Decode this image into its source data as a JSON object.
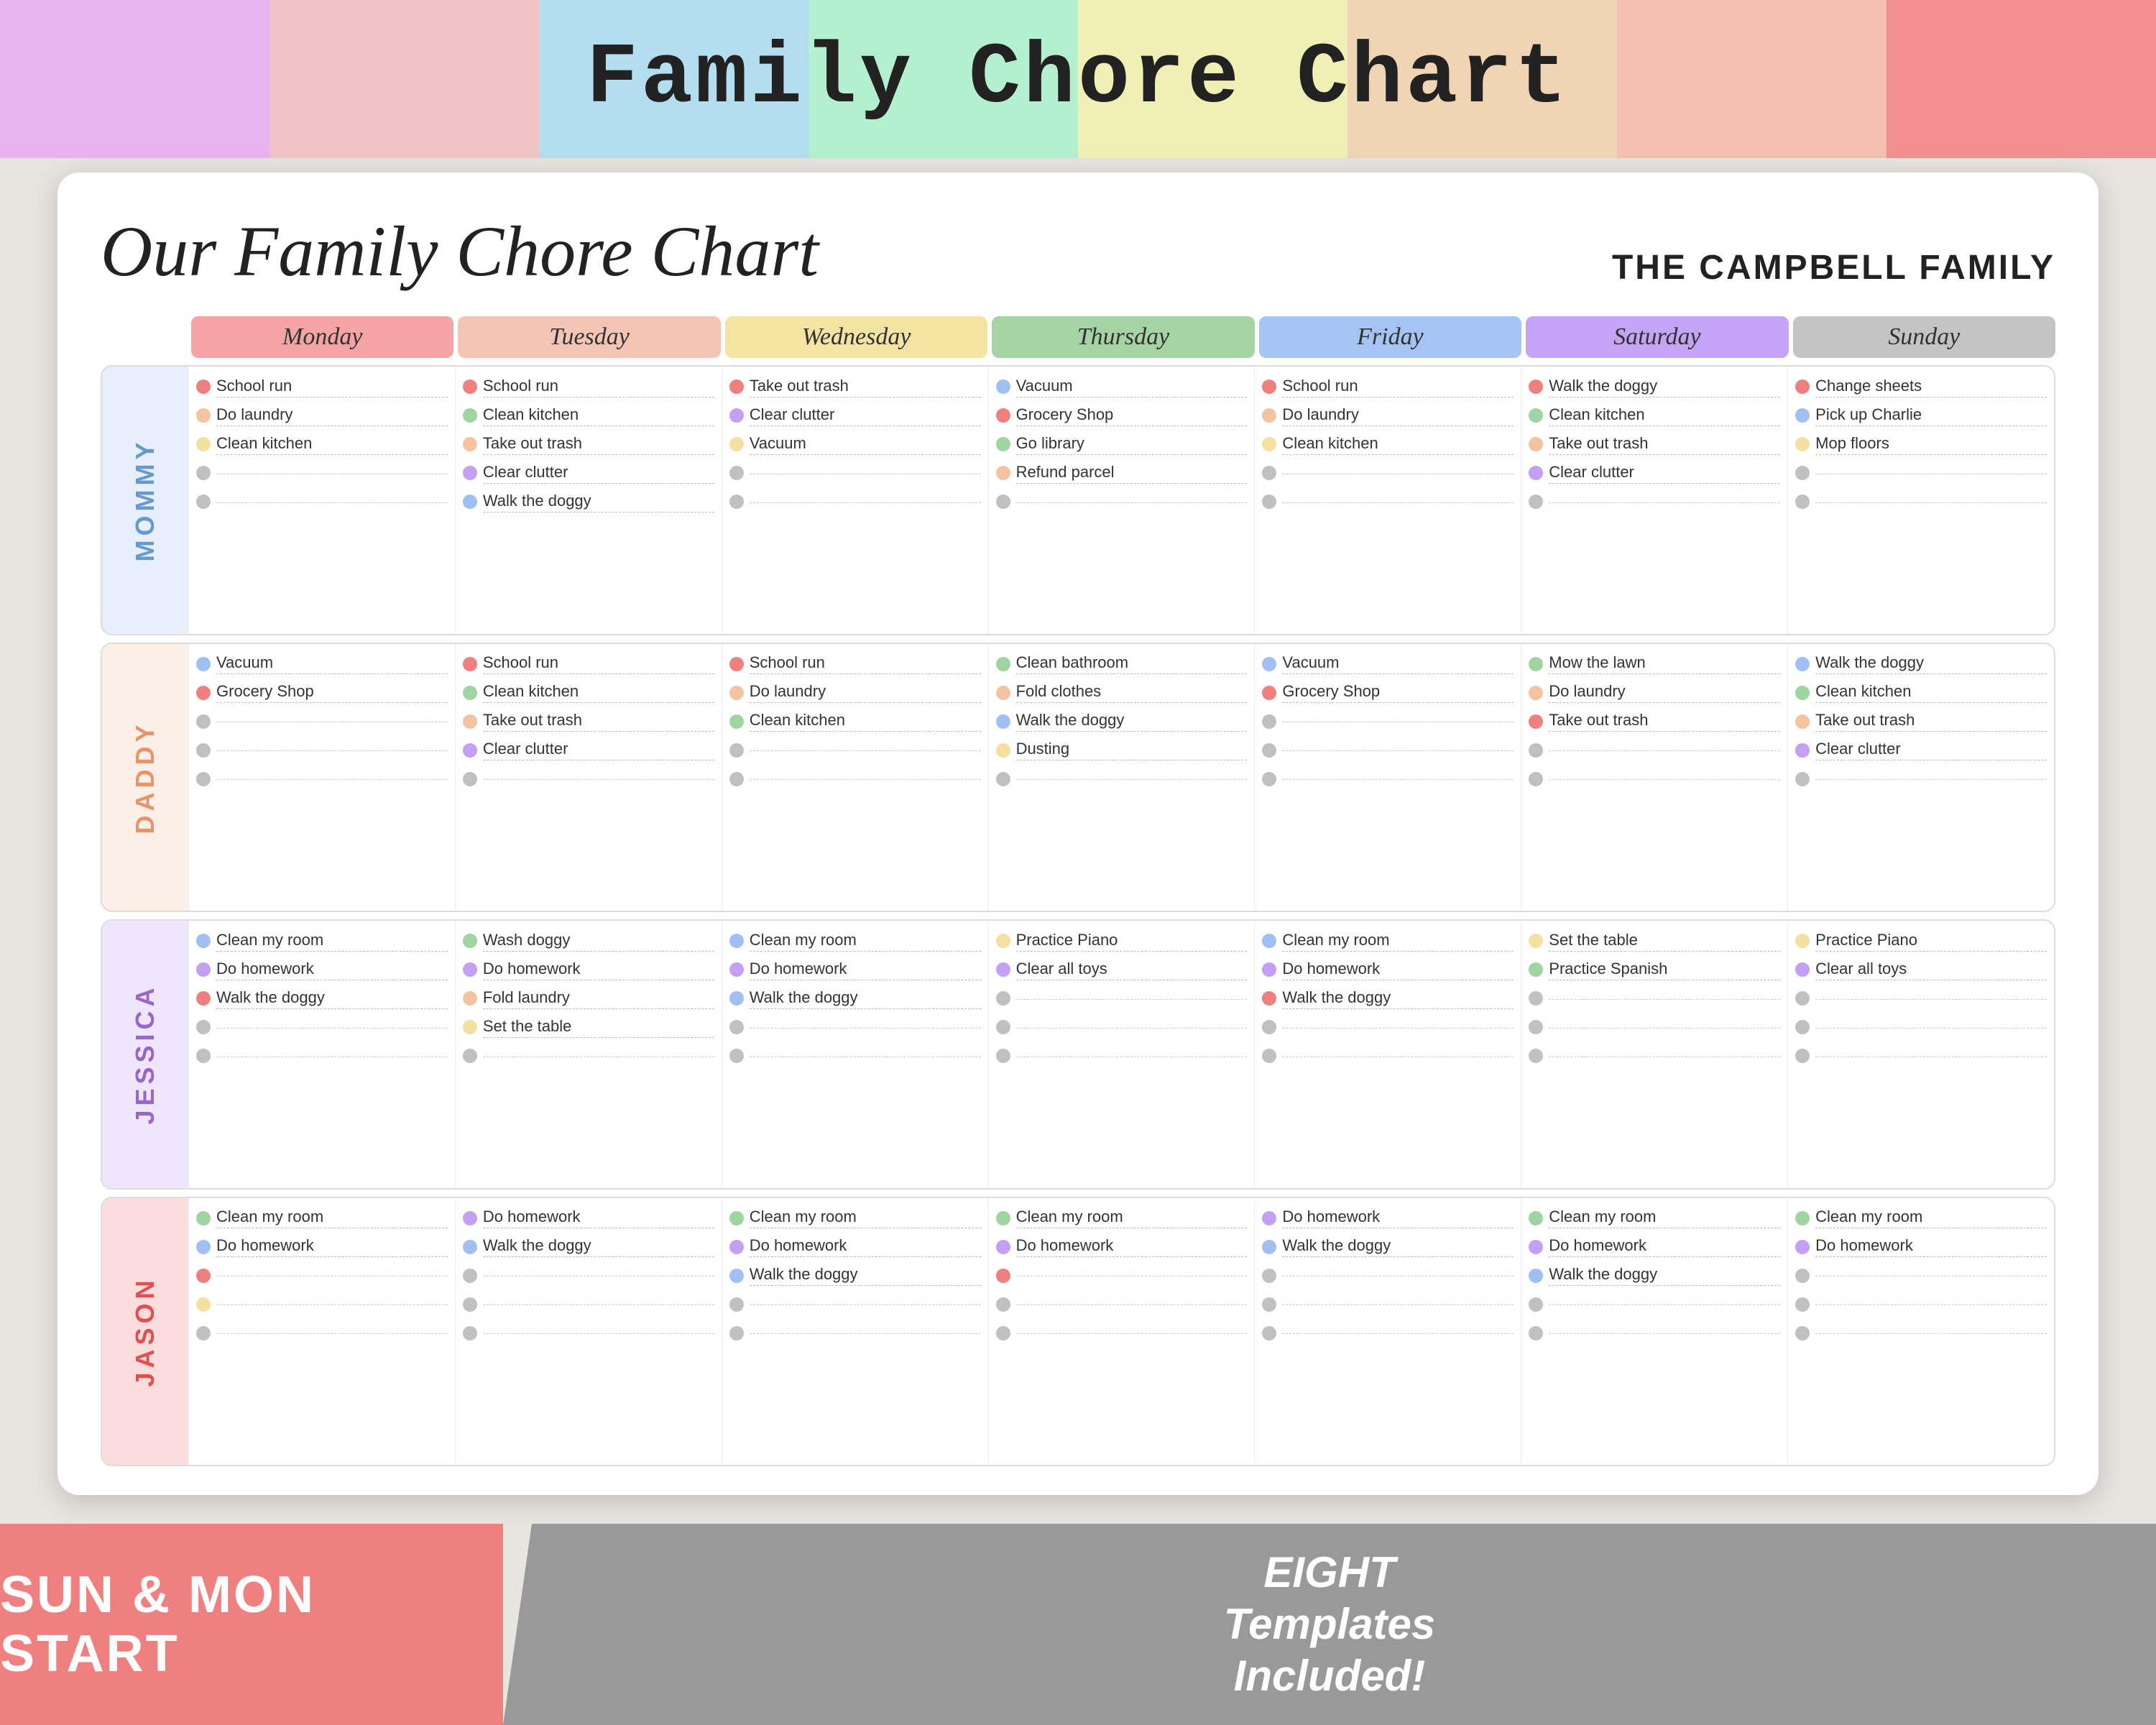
{
  "pageTitle": "Family Chore Chart",
  "topStrips": [
    {
      "color": "#e8b4f0"
    },
    {
      "color": "#f0c4c4"
    },
    {
      "color": "#b4def0"
    },
    {
      "color": "#b4f0d0"
    },
    {
      "color": "#f0f0b4"
    },
    {
      "color": "#f0d4b4"
    },
    {
      "color": "#f4c0b0"
    },
    {
      "color": "#f09090"
    }
  ],
  "cardScriptTitle": "Our Family Chore Chart",
  "familyName": "THE CAMPBELL FAMILY",
  "days": [
    {
      "label": "Monday",
      "color": "#f4a4a4"
    },
    {
      "label": "Tuesday",
      "color": "#f4c4b4"
    },
    {
      "label": "Wednesday",
      "color": "#f4e4a4"
    },
    {
      "label": "Thursday",
      "color": "#a4d4a4"
    },
    {
      "label": "Friday",
      "color": "#a4c4f4"
    },
    {
      "label": "Saturday",
      "color": "#c4a4f4"
    },
    {
      "label": "Sunday",
      "color": "#c4c4c4"
    }
  ],
  "persons": [
    {
      "name": "MOMMY",
      "color": "#a4c4f4",
      "textColor": "#6699cc",
      "days": [
        {
          "chores": [
            {
              "dot": "#f08080",
              "text": "School run"
            },
            {
              "dot": "#f4c4a0",
              "text": "Do laundry"
            },
            {
              "dot": "#f4e0a0",
              "text": "Clean kitchen"
            },
            {
              "dot": "#c0c0c0",
              "text": ""
            },
            {
              "dot": "#c0c0c0",
              "text": ""
            }
          ]
        },
        {
          "chores": [
            {
              "dot": "#f08080",
              "text": "School run"
            },
            {
              "dot": "#a0d4a0",
              "text": "Clean kitchen"
            },
            {
              "dot": "#f4c4a0",
              "text": "Take out trash"
            },
            {
              "dot": "#c4a0f4",
              "text": "Clear clutter"
            },
            {
              "dot": "#a0c0f4",
              "text": "Walk the doggy"
            }
          ]
        },
        {
          "chores": [
            {
              "dot": "#f08080",
              "text": "Take out trash"
            },
            {
              "dot": "#c4a0f4",
              "text": "Clear clutter"
            },
            {
              "dot": "#f4e0a0",
              "text": "Vacuum"
            },
            {
              "dot": "#c0c0c0",
              "text": ""
            },
            {
              "dot": "#c0c0c0",
              "text": ""
            }
          ]
        },
        {
          "chores": [
            {
              "dot": "#a0c0f4",
              "text": "Vacuum"
            },
            {
              "dot": "#f08080",
              "text": "Grocery Shop"
            },
            {
              "dot": "#a0d4a0",
              "text": "Go library"
            },
            {
              "dot": "#f4c4a0",
              "text": "Refund parcel"
            },
            {
              "dot": "#c0c0c0",
              "text": ""
            }
          ]
        },
        {
          "chores": [
            {
              "dot": "#f08080",
              "text": "School run"
            },
            {
              "dot": "#f4c4a0",
              "text": "Do laundry"
            },
            {
              "dot": "#f4e0a0",
              "text": "Clean kitchen"
            },
            {
              "dot": "#c0c0c0",
              "text": ""
            },
            {
              "dot": "#c0c0c0",
              "text": ""
            }
          ]
        },
        {
          "chores": [
            {
              "dot": "#f08080",
              "text": "Walk the doggy"
            },
            {
              "dot": "#a0d4a0",
              "text": "Clean kitchen"
            },
            {
              "dot": "#f4c4a0",
              "text": "Take out trash"
            },
            {
              "dot": "#c4a0f4",
              "text": "Clear clutter"
            },
            {
              "dot": "#c0c0c0",
              "text": ""
            }
          ]
        },
        {
          "chores": [
            {
              "dot": "#f08080",
              "text": "Change sheets"
            },
            {
              "dot": "#a0c0f4",
              "text": "Pick up Charlie"
            },
            {
              "dot": "#f4e0a0",
              "text": "Mop floors"
            },
            {
              "dot": "#c0c0c0",
              "text": ""
            },
            {
              "dot": "#c0c0c0",
              "text": ""
            }
          ]
        }
      ]
    },
    {
      "name": "DADDY",
      "color": "#f4c4a0",
      "textColor": "#e8946a",
      "days": [
        {
          "chores": [
            {
              "dot": "#a0c0f4",
              "text": "Vacuum"
            },
            {
              "dot": "#f08080",
              "text": "Grocery Shop"
            },
            {
              "dot": "#c0c0c0",
              "text": ""
            },
            {
              "dot": "#c0c0c0",
              "text": ""
            },
            {
              "dot": "#c0c0c0",
              "text": ""
            }
          ]
        },
        {
          "chores": [
            {
              "dot": "#f08080",
              "text": "School run"
            },
            {
              "dot": "#a0d4a0",
              "text": "Clean kitchen"
            },
            {
              "dot": "#f4c4a0",
              "text": "Take out trash"
            },
            {
              "dot": "#c4a0f4",
              "text": "Clear clutter"
            },
            {
              "dot": "#c0c0c0",
              "text": ""
            }
          ]
        },
        {
          "chores": [
            {
              "dot": "#f08080",
              "text": "School run"
            },
            {
              "dot": "#f4c4a0",
              "text": "Do laundry"
            },
            {
              "dot": "#a0d4a0",
              "text": "Clean kitchen"
            },
            {
              "dot": "#c0c0c0",
              "text": ""
            },
            {
              "dot": "#c0c0c0",
              "text": ""
            }
          ]
        },
        {
          "chores": [
            {
              "dot": "#a0d4a0",
              "text": "Clean bathroom"
            },
            {
              "dot": "#f4c4a0",
              "text": "Fold clothes"
            },
            {
              "dot": "#a0c0f4",
              "text": "Walk the doggy"
            },
            {
              "dot": "#f4e0a0",
              "text": "Dusting"
            },
            {
              "dot": "#c0c0c0",
              "text": ""
            }
          ]
        },
        {
          "chores": [
            {
              "dot": "#a0c0f4",
              "text": "Vacuum"
            },
            {
              "dot": "#f08080",
              "text": "Grocery Shop"
            },
            {
              "dot": "#c0c0c0",
              "text": ""
            },
            {
              "dot": "#c0c0c0",
              "text": ""
            },
            {
              "dot": "#c0c0c0",
              "text": ""
            }
          ]
        },
        {
          "chores": [
            {
              "dot": "#a0d4a0",
              "text": "Mow the lawn"
            },
            {
              "dot": "#f4c4a0",
              "text": "Do laundry"
            },
            {
              "dot": "#f08080",
              "text": "Take out trash"
            },
            {
              "dot": "#c0c0c0",
              "text": ""
            },
            {
              "dot": "#c0c0c0",
              "text": ""
            }
          ]
        },
        {
          "chores": [
            {
              "dot": "#a0c0f4",
              "text": "Walk the doggy"
            },
            {
              "dot": "#a0d4a0",
              "text": "Clean kitchen"
            },
            {
              "dot": "#f4c4a0",
              "text": "Take out trash"
            },
            {
              "dot": "#c4a0f4",
              "text": "Clear clutter"
            },
            {
              "dot": "#c0c0c0",
              "text": ""
            }
          ]
        }
      ]
    },
    {
      "name": "JESSICA",
      "color": "#c4a0f4",
      "textColor": "#9966cc",
      "days": [
        {
          "chores": [
            {
              "dot": "#a0c0f4",
              "text": "Clean my room"
            },
            {
              "dot": "#c4a0f4",
              "text": "Do homework"
            },
            {
              "dot": "#f08080",
              "text": "Walk the doggy"
            },
            {
              "dot": "#c0c0c0",
              "text": ""
            },
            {
              "dot": "#c0c0c0",
              "text": ""
            }
          ]
        },
        {
          "chores": [
            {
              "dot": "#a0d4a0",
              "text": "Wash doggy"
            },
            {
              "dot": "#c4a0f4",
              "text": "Do homework"
            },
            {
              "dot": "#f4c4a0",
              "text": "Fold laundry"
            },
            {
              "dot": "#f4e0a0",
              "text": "Set the table"
            },
            {
              "dot": "#c0c0c0",
              "text": ""
            }
          ]
        },
        {
          "chores": [
            {
              "dot": "#a0c0f4",
              "text": "Clean my room"
            },
            {
              "dot": "#c4a0f4",
              "text": "Do homework"
            },
            {
              "dot": "#a0c0f4",
              "text": "Walk the doggy"
            },
            {
              "dot": "#c0c0c0",
              "text": ""
            },
            {
              "dot": "#c0c0c0",
              "text": ""
            }
          ]
        },
        {
          "chores": [
            {
              "dot": "#f4e0a0",
              "text": "Practice Piano"
            },
            {
              "dot": "#c4a0f4",
              "text": "Clear all toys"
            },
            {
              "dot": "#c0c0c0",
              "text": ""
            },
            {
              "dot": "#c0c0c0",
              "text": ""
            },
            {
              "dot": "#c0c0c0",
              "text": ""
            }
          ]
        },
        {
          "chores": [
            {
              "dot": "#a0c0f4",
              "text": "Clean my room"
            },
            {
              "dot": "#c4a0f4",
              "text": "Do homework"
            },
            {
              "dot": "#f08080",
              "text": "Walk the doggy"
            },
            {
              "dot": "#c0c0c0",
              "text": ""
            },
            {
              "dot": "#c0c0c0",
              "text": ""
            }
          ]
        },
        {
          "chores": [
            {
              "dot": "#f4e0a0",
              "text": "Set the table"
            },
            {
              "dot": "#a0d4a0",
              "text": "Practice Spanish"
            },
            {
              "dot": "#c0c0c0",
              "text": ""
            },
            {
              "dot": "#c0c0c0",
              "text": ""
            },
            {
              "dot": "#c0c0c0",
              "text": ""
            }
          ]
        },
        {
          "chores": [
            {
              "dot": "#f4e0a0",
              "text": "Practice Piano"
            },
            {
              "dot": "#c4a0f4",
              "text": "Clear all toys"
            },
            {
              "dot": "#c0c0c0",
              "text": ""
            },
            {
              "dot": "#c0c0c0",
              "text": ""
            },
            {
              "dot": "#c0c0c0",
              "text": ""
            }
          ]
        }
      ]
    },
    {
      "name": "JASON",
      "color": "#f08080",
      "textColor": "#e05050",
      "days": [
        {
          "chores": [
            {
              "dot": "#a0d4a0",
              "text": "Clean my room"
            },
            {
              "dot": "#a0c0f4",
              "text": "Do homework"
            },
            {
              "dot": "#f08080",
              "text": ""
            },
            {
              "dot": "#f4e0a0",
              "text": ""
            },
            {
              "dot": "#c0c0c0",
              "text": ""
            }
          ]
        },
        {
          "chores": [
            {
              "dot": "#c4a0f4",
              "text": "Do homework"
            },
            {
              "dot": "#a0c0f4",
              "text": "Walk the doggy"
            },
            {
              "dot": "#c0c0c0",
              "text": ""
            },
            {
              "dot": "#c0c0c0",
              "text": ""
            },
            {
              "dot": "#c0c0c0",
              "text": ""
            }
          ]
        },
        {
          "chores": [
            {
              "dot": "#a0d4a0",
              "text": "Clean my room"
            },
            {
              "dot": "#c4a0f4",
              "text": "Do homework"
            },
            {
              "dot": "#a0c0f4",
              "text": "Walk the doggy"
            },
            {
              "dot": "#c0c0c0",
              "text": ""
            },
            {
              "dot": "#c0c0c0",
              "text": ""
            }
          ]
        },
        {
          "chores": [
            {
              "dot": "#a0d4a0",
              "text": "Clean my room"
            },
            {
              "dot": "#c4a0f4",
              "text": "Do homework"
            },
            {
              "dot": "#f08080",
              "text": ""
            },
            {
              "dot": "#c0c0c0",
              "text": ""
            },
            {
              "dot": "#c0c0c0",
              "text": ""
            }
          ]
        },
        {
          "chores": [
            {
              "dot": "#c4a0f4",
              "text": "Do homework"
            },
            {
              "dot": "#a0c0f4",
              "text": "Walk the doggy"
            },
            {
              "dot": "#c0c0c0",
              "text": ""
            },
            {
              "dot": "#c0c0c0",
              "text": ""
            },
            {
              "dot": "#c0c0c0",
              "text": ""
            }
          ]
        },
        {
          "chores": [
            {
              "dot": "#a0d4a0",
              "text": "Clean my room"
            },
            {
              "dot": "#c4a0f4",
              "text": "Do homework"
            },
            {
              "dot": "#a0c0f4",
              "text": "Walk the doggy"
            },
            {
              "dot": "#c0c0c0",
              "text": ""
            },
            {
              "dot": "#c0c0c0",
              "text": ""
            }
          ]
        },
        {
          "chores": [
            {
              "dot": "#a0d4a0",
              "text": "Clean my room"
            },
            {
              "dot": "#c4a0f4",
              "text": "Do homework"
            },
            {
              "dot": "#c0c0c0",
              "text": ""
            },
            {
              "dot": "#c0c0c0",
              "text": ""
            },
            {
              "dot": "#c0c0c0",
              "text": ""
            }
          ]
        }
      ]
    }
  ],
  "bottomLeft": "SUN & MON Start",
  "bottomRight": "EIGHT\nTemplates\nIncluded!"
}
